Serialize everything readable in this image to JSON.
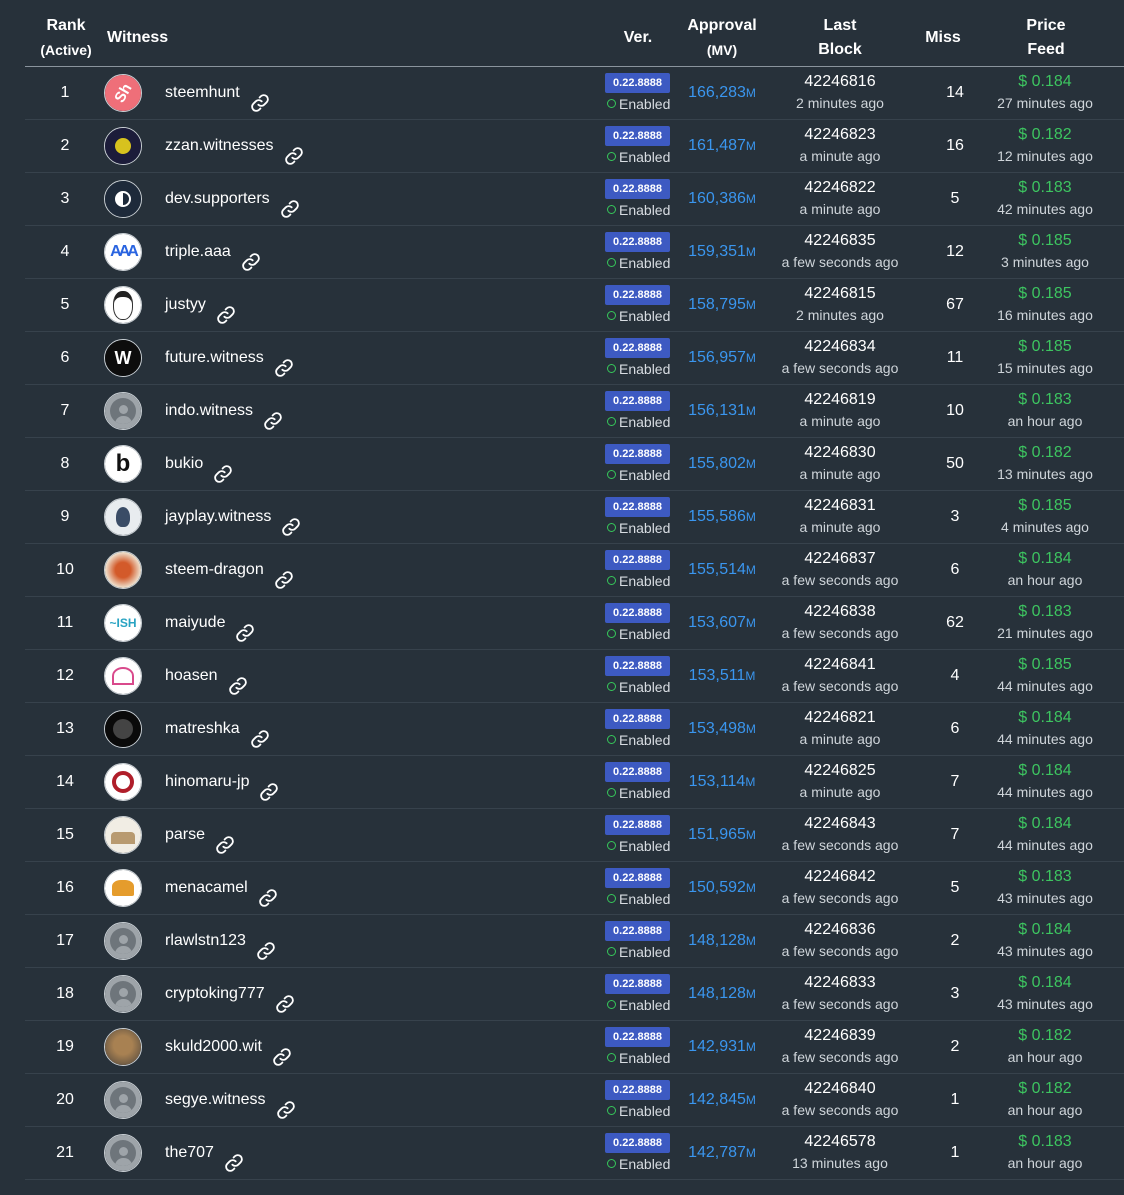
{
  "headers": {
    "rank": "Rank",
    "rank_sub": "(Active)",
    "witness": "Witness",
    "ver": "Ver.",
    "approval": "Approval",
    "approval_sub": "(MV)",
    "last_block_1": "Last",
    "last_block_2": "Block",
    "miss": "Miss",
    "price_1": "Price",
    "price_2": "Feed"
  },
  "status_label": "Enabled",
  "approval_unit": "M",
  "colors": {
    "background": "#27313a",
    "version_badge": "#3d5ac2",
    "approval": "#3a96ef",
    "price": "#3dc560",
    "enabled_dot": "#36c75a"
  },
  "rows": [
    {
      "rank": "1",
      "name": "steemhunt",
      "avatar": "sh",
      "version": "0.22.8888",
      "approval": "166,283",
      "last_block": "42246816",
      "block_ago": "2 minutes ago",
      "miss": "14",
      "price": "$ 0.184",
      "price_ago": "27 minutes ago"
    },
    {
      "rank": "2",
      "name": "zzan.witnesses",
      "avatar": "zz",
      "version": "0.22.8888",
      "approval": "161,487",
      "last_block": "42246823",
      "block_ago": "a minute ago",
      "miss": "16",
      "price": "$ 0.182",
      "price_ago": "12 minutes ago"
    },
    {
      "rank": "3",
      "name": "dev.supporters",
      "avatar": "dev",
      "version": "0.22.8888",
      "approval": "160,386",
      "last_block": "42246822",
      "block_ago": "a minute ago",
      "miss": "5",
      "price": "$ 0.183",
      "price_ago": "42 minutes ago"
    },
    {
      "rank": "4",
      "name": "triple.aaa",
      "avatar": "aaa",
      "version": "0.22.8888",
      "approval": "159,351",
      "last_block": "42246835",
      "block_ago": "a few seconds ago",
      "miss": "12",
      "price": "$ 0.185",
      "price_ago": "3 minutes ago"
    },
    {
      "rank": "5",
      "name": "justyy",
      "avatar": "face",
      "version": "0.22.8888",
      "approval": "158,795",
      "last_block": "42246815",
      "block_ago": "2 minutes ago",
      "miss": "67",
      "price": "$ 0.185",
      "price_ago": "16 minutes ago"
    },
    {
      "rank": "6",
      "name": "future.witness",
      "avatar": "fw",
      "version": "0.22.8888",
      "approval": "156,957",
      "last_block": "42246834",
      "block_ago": "a few seconds ago",
      "miss": "11",
      "price": "$ 0.185",
      "price_ago": "15 minutes ago"
    },
    {
      "rank": "7",
      "name": "indo.witness",
      "avatar": "default",
      "version": "0.22.8888",
      "approval": "156,131",
      "last_block": "42246819",
      "block_ago": "a minute ago",
      "miss": "10",
      "price": "$ 0.183",
      "price_ago": "an hour ago"
    },
    {
      "rank": "8",
      "name": "bukio",
      "avatar": "b",
      "version": "0.22.8888",
      "approval": "155,802",
      "last_block": "42246830",
      "block_ago": "a minute ago",
      "miss": "50",
      "price": "$ 0.182",
      "price_ago": "13 minutes ago"
    },
    {
      "rank": "9",
      "name": "jayplay.witness",
      "avatar": "bird",
      "version": "0.22.8888",
      "approval": "155,586",
      "last_block": "42246831",
      "block_ago": "a minute ago",
      "miss": "3",
      "price": "$ 0.185",
      "price_ago": "4 minutes ago"
    },
    {
      "rank": "10",
      "name": "steem-dragon",
      "avatar": "dragon",
      "version": "0.22.8888",
      "approval": "155,514",
      "last_block": "42246837",
      "block_ago": "a few seconds ago",
      "miss": "6",
      "price": "$ 0.184",
      "price_ago": "an hour ago"
    },
    {
      "rank": "11",
      "name": "maiyude",
      "avatar": "fish",
      "version": "0.22.8888",
      "approval": "153,607",
      "last_block": "42246838",
      "block_ago": "a few seconds ago",
      "miss": "62",
      "price": "$ 0.183",
      "price_ago": "21 minutes ago"
    },
    {
      "rank": "12",
      "name": "hoasen",
      "avatar": "lotus",
      "version": "0.22.8888",
      "approval": "153,511",
      "last_block": "42246841",
      "block_ago": "a few seconds ago",
      "miss": "4",
      "price": "$ 0.185",
      "price_ago": "44 minutes ago"
    },
    {
      "rank": "13",
      "name": "matreshka",
      "avatar": "dark",
      "version": "0.22.8888",
      "approval": "153,498",
      "last_block": "42246821",
      "block_ago": "a minute ago",
      "miss": "6",
      "price": "$ 0.184",
      "price_ago": "44 minutes ago"
    },
    {
      "rank": "14",
      "name": "hinomaru-jp",
      "avatar": "steem",
      "version": "0.22.8888",
      "approval": "153,114",
      "last_block": "42246825",
      "block_ago": "a minute ago",
      "miss": "7",
      "price": "$ 0.184",
      "price_ago": "44 minutes ago"
    },
    {
      "rank": "15",
      "name": "parse",
      "avatar": "sofa",
      "version": "0.22.8888",
      "approval": "151,965",
      "last_block": "42246843",
      "block_ago": "a few seconds ago",
      "miss": "7",
      "price": "$ 0.184",
      "price_ago": "44 minutes ago"
    },
    {
      "rank": "16",
      "name": "menacamel",
      "avatar": "camel",
      "version": "0.22.8888",
      "approval": "150,592",
      "last_block": "42246842",
      "block_ago": "a few seconds ago",
      "miss": "5",
      "price": "$ 0.183",
      "price_ago": "43 minutes ago"
    },
    {
      "rank": "17",
      "name": "rlawlstn123",
      "avatar": "default",
      "version": "0.22.8888",
      "approval": "148,128",
      "last_block": "42246836",
      "block_ago": "a few seconds ago",
      "miss": "2",
      "price": "$ 0.184",
      "price_ago": "43 minutes ago"
    },
    {
      "rank": "18",
      "name": "cryptoking777",
      "avatar": "default",
      "version": "0.22.8888",
      "approval": "148,128",
      "last_block": "42246833",
      "block_ago": "a few seconds ago",
      "miss": "3",
      "price": "$ 0.184",
      "price_ago": "43 minutes ago"
    },
    {
      "rank": "19",
      "name": "skuld2000.wit",
      "avatar": "cat",
      "version": "0.22.8888",
      "approval": "142,931",
      "last_block": "42246839",
      "block_ago": "a few seconds ago",
      "miss": "2",
      "price": "$ 0.182",
      "price_ago": "an hour ago"
    },
    {
      "rank": "20",
      "name": "segye.witness",
      "avatar": "default",
      "version": "0.22.8888",
      "approval": "142,845",
      "last_block": "42246840",
      "block_ago": "a few seconds ago",
      "miss": "1",
      "price": "$ 0.182",
      "price_ago": "an hour ago"
    },
    {
      "rank": "21",
      "name": "the707",
      "avatar": "default",
      "version": "0.22.8888",
      "approval": "142,787",
      "last_block": "42246578",
      "block_ago": "13 minutes ago",
      "miss": "1",
      "price": "$ 0.183",
      "price_ago": "an hour ago"
    }
  ]
}
